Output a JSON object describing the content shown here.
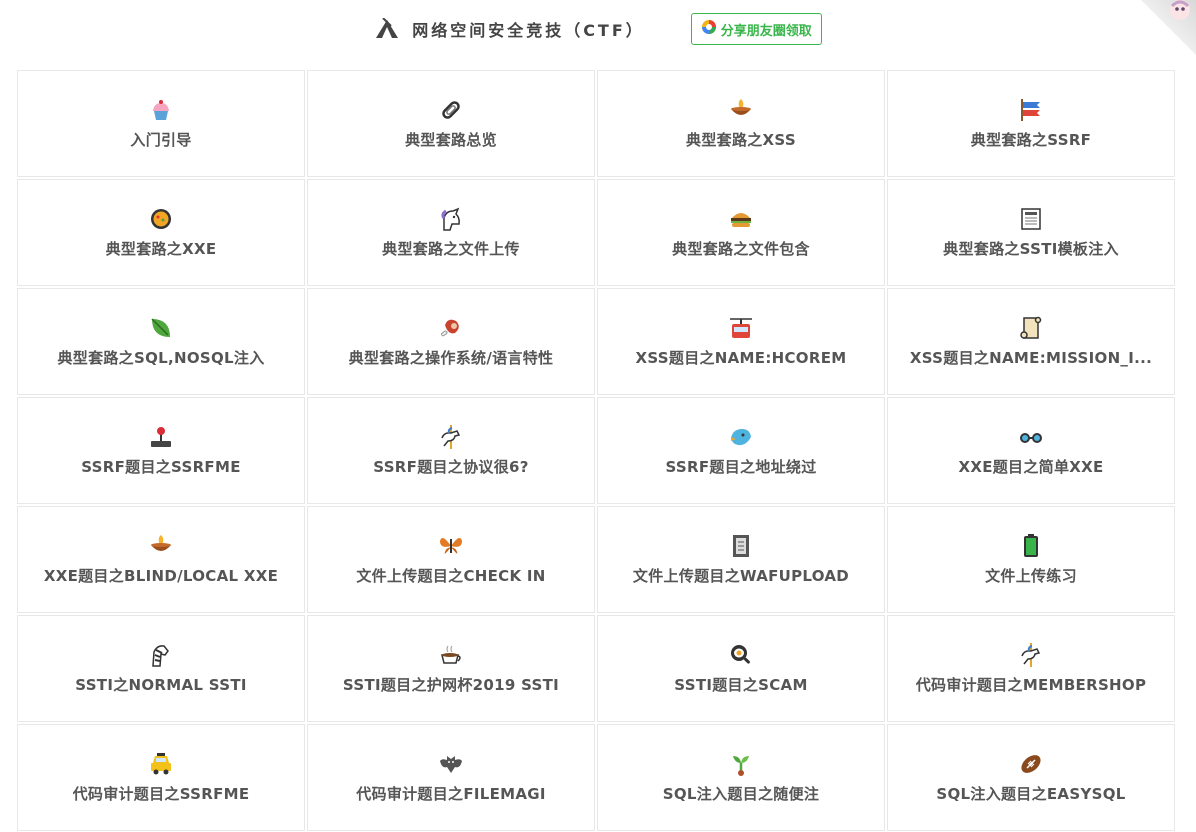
{
  "header": {
    "title": "网络空间安全竞技（CTF）",
    "share_label": "分享朋友圈领取"
  },
  "cards": [
    {
      "label": "入门引导",
      "icon": "cupcake-icon"
    },
    {
      "label": "典型套路总览",
      "icon": "paperclip-icon"
    },
    {
      "label": "典型套路之XSS",
      "icon": "diya-lamp-icon"
    },
    {
      "label": "典型套路之SSRF",
      "icon": "carp-streamer-icon"
    },
    {
      "label": "典型套路之XXE",
      "icon": "paella-icon"
    },
    {
      "label": "典型套路之文件上传",
      "icon": "unicorn-icon"
    },
    {
      "label": "典型套路之文件包含",
      "icon": "burger-icon"
    },
    {
      "label": "典型套路之SSTI模板注入",
      "icon": "newspaper-icon"
    },
    {
      "label": "典型套路之SQL,NOSQL注入",
      "icon": "leaf-icon"
    },
    {
      "label": "典型套路之操作系统/语言特性",
      "icon": "meat-icon"
    },
    {
      "label": "XSS题目之NAME:HCOREM",
      "icon": "cable-car-icon"
    },
    {
      "label": "XSS题目之NAME:MISSION_I...",
      "icon": "scroll-icon"
    },
    {
      "label": "SSRF题目之SSRFME",
      "icon": "joystick-icon"
    },
    {
      "label": "SSRF题目之协议很6?",
      "icon": "carousel-horse-icon"
    },
    {
      "label": "SSRF题目之地址绕过",
      "icon": "bird-icon"
    },
    {
      "label": "XXE题目之简单XXE",
      "icon": "goggles-icon"
    },
    {
      "label": "XXE题目之BLIND/LOCAL XXE",
      "icon": "diya-lamp-icon"
    },
    {
      "label": "文件上传题目之CHECK IN",
      "icon": "butterfly-icon"
    },
    {
      "label": "文件上传题目之WAFUPLOAD",
      "icon": "notebook-icon"
    },
    {
      "label": "文件上传练习",
      "icon": "battery-icon"
    },
    {
      "label": "SSTI之NORMAL SSTI",
      "icon": "zebra-icon"
    },
    {
      "label": "SSTI题目之护网杯2019 SSTI",
      "icon": "coffee-icon"
    },
    {
      "label": "SSTI题目之SCAM",
      "icon": "frying-pan-icon"
    },
    {
      "label": "代码审计题目之MEMBERSHOP",
      "icon": "carousel-horse-icon"
    },
    {
      "label": "代码审计题目之SSRFME",
      "icon": "taxi-icon"
    },
    {
      "label": "代码审计题目之FILEMAGI",
      "icon": "bat-icon"
    },
    {
      "label": "SQL注入题目之随便注",
      "icon": "seedling-icon"
    },
    {
      "label": "SQL注入题目之EASYSQL",
      "icon": "football-icon"
    }
  ]
}
